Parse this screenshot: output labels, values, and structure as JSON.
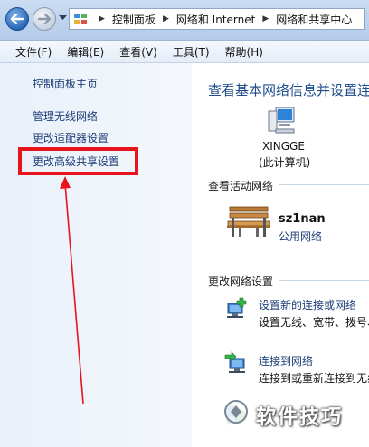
{
  "address_bar": {
    "crumbs": [
      "控制面板",
      "网络和 Internet",
      "网络和共享中心"
    ]
  },
  "menu": [
    "文件(F)",
    "编辑(E)",
    "查看(V)",
    "工具(T)",
    "帮助(H)"
  ],
  "left_pane": {
    "home": "控制面板主页",
    "tasks": [
      "管理无线网络",
      "更改适配器设置",
      "更改高级共享设置"
    ],
    "annotation_color": "#e8131b"
  },
  "main": {
    "title": "查看基本网络信息并设置连",
    "computer": {
      "name": "XINGGE",
      "subtitle": "(此计算机)"
    },
    "active_networks_heading": "查看活动网络",
    "network": {
      "name": "sz1nan",
      "type": "公用网络"
    },
    "change_settings_heading": "更改网络设置",
    "settings": [
      {
        "link": "设置新的连接或网络",
        "desc": "设置无线、宽带、拨号、",
        "icon": "new-connection-icon"
      },
      {
        "link": "连接到网络",
        "desc": "连接到或重新连接到无线",
        "icon": "connect-network-icon"
      },
      {
        "link": "",
        "desc": "",
        "icon": "homegroup-icon"
      }
    ]
  },
  "watermark": "软件技巧"
}
